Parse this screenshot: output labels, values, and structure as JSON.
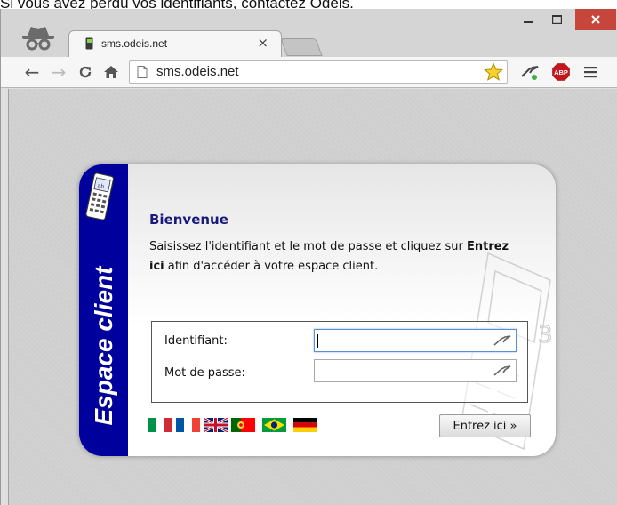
{
  "caption": "Si vous avez perdu vos identifiants, contactez Odeis.",
  "browser": {
    "tab": {
      "title": "sms.odeis.net",
      "close_glyph": "×"
    },
    "window_controls": {
      "minimize": "–",
      "maximize": "☐",
      "close": "×"
    },
    "nav": {
      "back": "←",
      "forward": "→"
    },
    "address": {
      "url": "sms.odeis.net"
    },
    "icons": [
      "incognito-icon",
      "page-icon",
      "bookmark-star-icon",
      "extension-icon",
      "adblock-plus-icon",
      "menu-icon",
      "reload-icon",
      "home-icon"
    ],
    "extension": {
      "abp_label": "ABP"
    }
  },
  "login": {
    "sidebar_label": "Espace client",
    "welcome": "Bienvenue",
    "intro_before": "Saisissez l'identifiant et le mot de passe et cliquez sur ",
    "intro_strong": "Entrez ici",
    "intro_after": " afin d'accéder à votre espace client.",
    "fields": {
      "id_label": "Identifiant:",
      "id_value": "",
      "pw_label": "Mot de passe:",
      "pw_value": ""
    },
    "submit_label": "Entrez ici »",
    "background_digits": "3 0",
    "phone_screen_label": "ab",
    "languages": [
      "it",
      "fr",
      "en-gb",
      "pt",
      "pt-br",
      "de"
    ]
  },
  "colors": {
    "sidebar": "#00009c",
    "title": "#1a1a7e",
    "close_button": "#c7463b",
    "abp": "#c4161c"
  }
}
